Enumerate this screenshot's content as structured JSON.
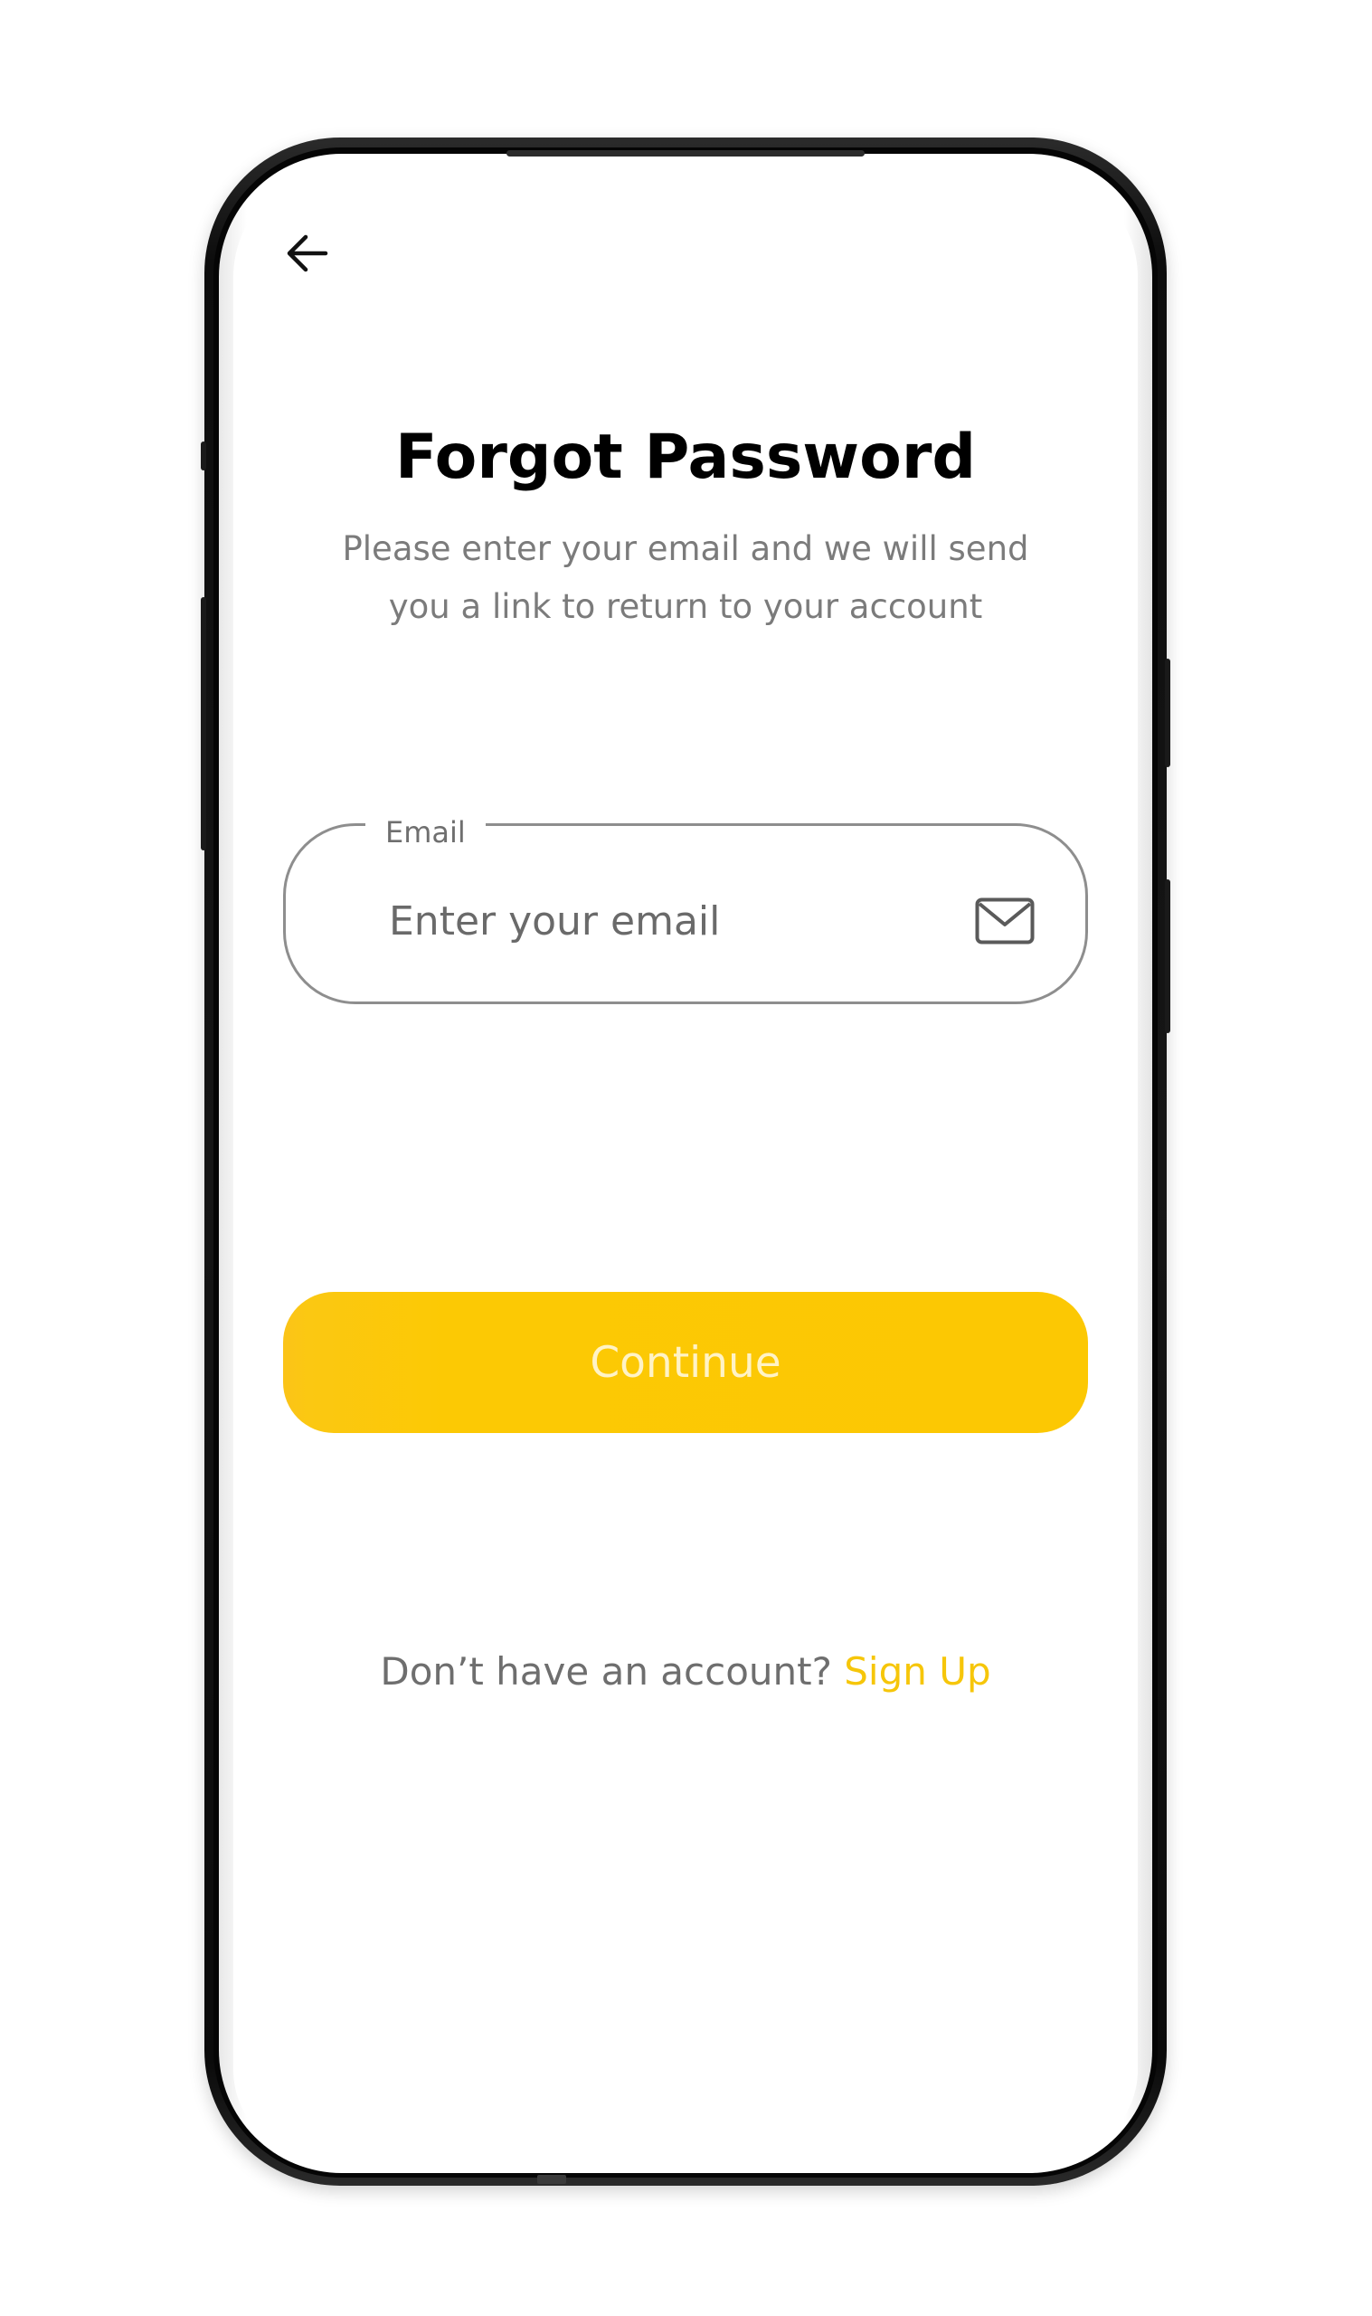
{
  "header": {
    "back_icon": "arrow-left-icon"
  },
  "main": {
    "title": "Forgot Password",
    "subtitle_line1": "Please enter your email and we will send",
    "subtitle_line2": "you a link to return to your account"
  },
  "form": {
    "email_label": "Email",
    "email_placeholder": "Enter your email",
    "email_value": "",
    "email_icon": "mail-icon",
    "continue_label": "Continue"
  },
  "footer": {
    "signup_prompt": "Don’t have an account?",
    "signup_link": "Sign Up"
  },
  "colors": {
    "accent": "#FCC803",
    "link": "#F6C60A",
    "title": "#000000",
    "muted_text": "#7B7B7B",
    "field_border": "#8E8E8E"
  }
}
